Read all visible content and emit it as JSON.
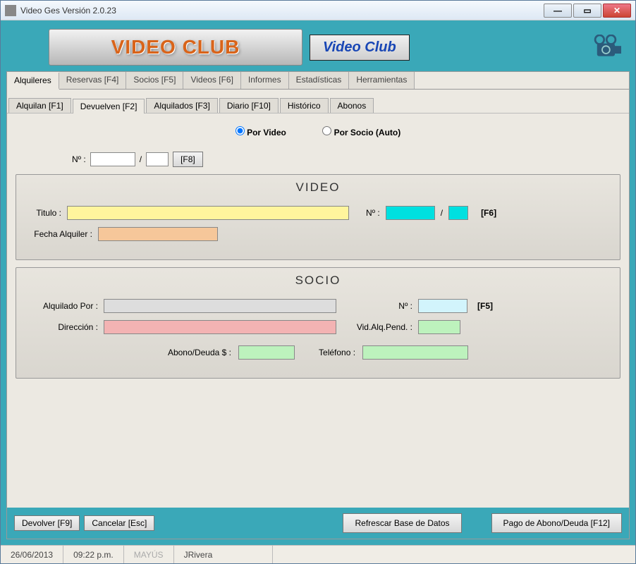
{
  "window": {
    "title": "Video Ges Versión 2.0.23"
  },
  "branding": {
    "banner": "VIDEO CLUB",
    "tag": "Video Club"
  },
  "tabs": {
    "main": [
      "Alquileres",
      "Reservas [F4]",
      "Socios [F5]",
      "Videos [F6]",
      "Informes",
      "Estadísticas",
      "Herramientas"
    ],
    "main_active": 0,
    "sub": [
      "Alquilan [F1]",
      "Devuelven [F2]",
      "Alquilados [F3]",
      "Diario [F10]",
      "Histórico",
      "Abonos"
    ],
    "sub_active": 1
  },
  "radios": {
    "porVideo": "Por Video",
    "porSocio": "Por Socio (Auto)",
    "selected": "porVideo"
  },
  "numrow": {
    "label": "Nº :",
    "sep": "/",
    "btn": "[F8]",
    "val1": "",
    "val2": ""
  },
  "video": {
    "title": "VIDEO",
    "tituloLabel": "Titulo :",
    "tituloVal": "",
    "nLabel": "Nº :",
    "nSep": "/",
    "nVal1": "",
    "nVal2": "",
    "nBtn": "[F6]",
    "fechaLabel": "Fecha Alquiler :",
    "fechaVal": ""
  },
  "socio": {
    "title": "SOCIO",
    "alqLabel": "Alquilado Por :",
    "alqVal": "",
    "nLabel": "Nº :",
    "nVal": "",
    "nBtn": "[F5]",
    "dirLabel": "Dirección :",
    "dirVal": "",
    "pendLabel": "Vid.Alq.Pend. :",
    "pendVal": "",
    "abonoLabel": "Abono/Deuda $ :",
    "abonoVal": "",
    "telLabel": "Teléfono :",
    "telVal": ""
  },
  "buttons": {
    "devolver": "Devolver [F9]",
    "cancelar": "Cancelar [Esc]",
    "refrescar": "Refrescar Base de Datos",
    "pago": "Pago de Abono/Deuda [F12]"
  },
  "status": {
    "date": "26/06/2013",
    "time": "09:22 p.m.",
    "caps": "MAYÚS",
    "user": "JRivera"
  }
}
